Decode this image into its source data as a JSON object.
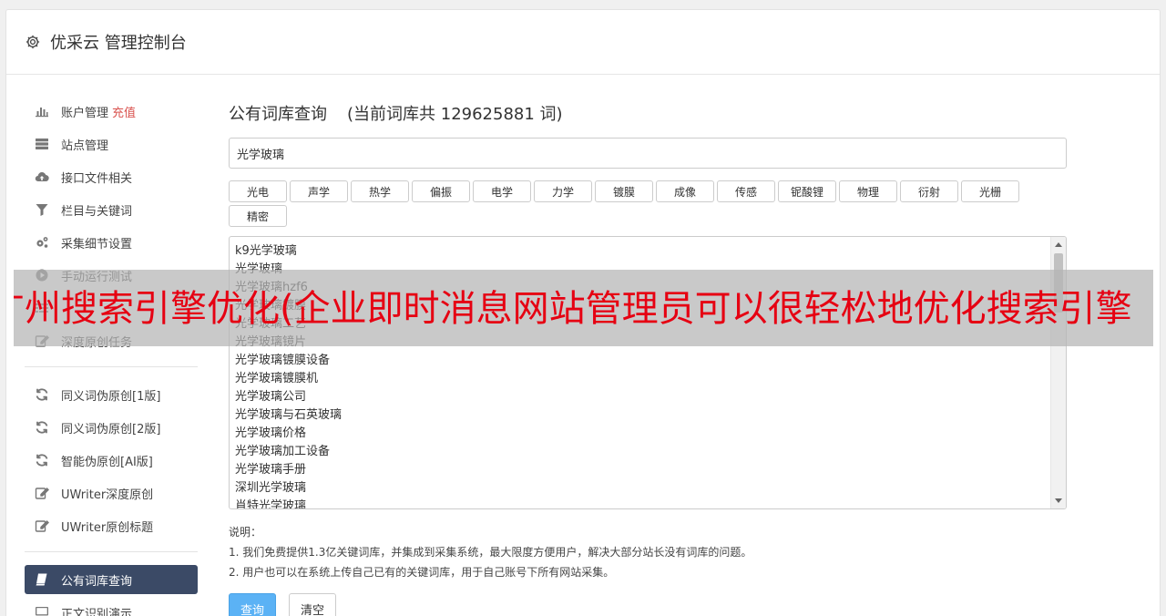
{
  "header": {
    "title": "优采云 管理控制台"
  },
  "sidebar": {
    "group1": [
      {
        "label": "账户管理",
        "highlight": "充值",
        "icon": "bar-chart-icon"
      },
      {
        "label": "站点管理",
        "icon": "server-icon"
      },
      {
        "label": "接口文件相关",
        "icon": "cloud-upload-icon"
      },
      {
        "label": "栏目与关键词",
        "icon": "filter-icon"
      },
      {
        "label": "采集细节设置",
        "icon": "gears-icon"
      },
      {
        "label": "手动运行测试",
        "icon": "play-circle-icon"
      },
      {
        "label": "",
        "icon": "list-icon"
      },
      {
        "label": "深度原创任务",
        "icon": "edit-icon"
      }
    ],
    "group2": [
      {
        "label": "同义词伪原创[1版]",
        "icon": "refresh-icon"
      },
      {
        "label": "同义词伪原创[2版]",
        "icon": "refresh-icon"
      },
      {
        "label": "智能伪原创[AI版]",
        "icon": "refresh-icon"
      },
      {
        "label": "UWriter深度原创",
        "icon": "edit-icon"
      },
      {
        "label": "UWriter原创标题",
        "icon": "edit-icon"
      }
    ],
    "group3": [
      {
        "label": "公有词库查询",
        "icon": "book-icon",
        "active": true
      },
      {
        "label": "正文识别演示",
        "icon": "monitor-icon"
      }
    ]
  },
  "main": {
    "title": "公有词库查询",
    "count_text": "(当前词库共 129625881 词)",
    "search_value": "光学玻璃",
    "tags": [
      "光电",
      "声学",
      "热学",
      "偏振",
      "电学",
      "力学",
      "镀膜",
      "成像",
      "传感",
      "铌酸锂",
      "物理",
      "衍射",
      "光栅",
      "精密"
    ],
    "results": [
      "k9光学玻璃",
      "光学玻璃",
      "光学玻璃hzf6",
      "光学玻璃镀膜",
      "光学玻璃工艺",
      "光学玻璃镜片",
      "光学玻璃镀膜设备",
      "光学玻璃镀膜机",
      "光学玻璃公司",
      "光学玻璃与石英玻璃",
      "光学玻璃价格",
      "光学玻璃加工设备",
      "光学玻璃手册",
      "深圳光学玻璃",
      "肖特光学玻璃"
    ],
    "notes_title": "说明：",
    "notes": [
      "1. 我们免费提供1.3亿关键词库，并集成到采集系统，最大限度方便用户，解决大部分站长没有词库的问题。",
      "2. 用户也可以在系统上传自己已有的关键词库，用于自己账号下所有网站采集。"
    ],
    "query_button": "查询",
    "clear_button": "清空"
  },
  "overlay": {
    "text": "广州搜索引擎优化(企业即时消息网站管理员可以很轻松地优化搜索引擎"
  }
}
